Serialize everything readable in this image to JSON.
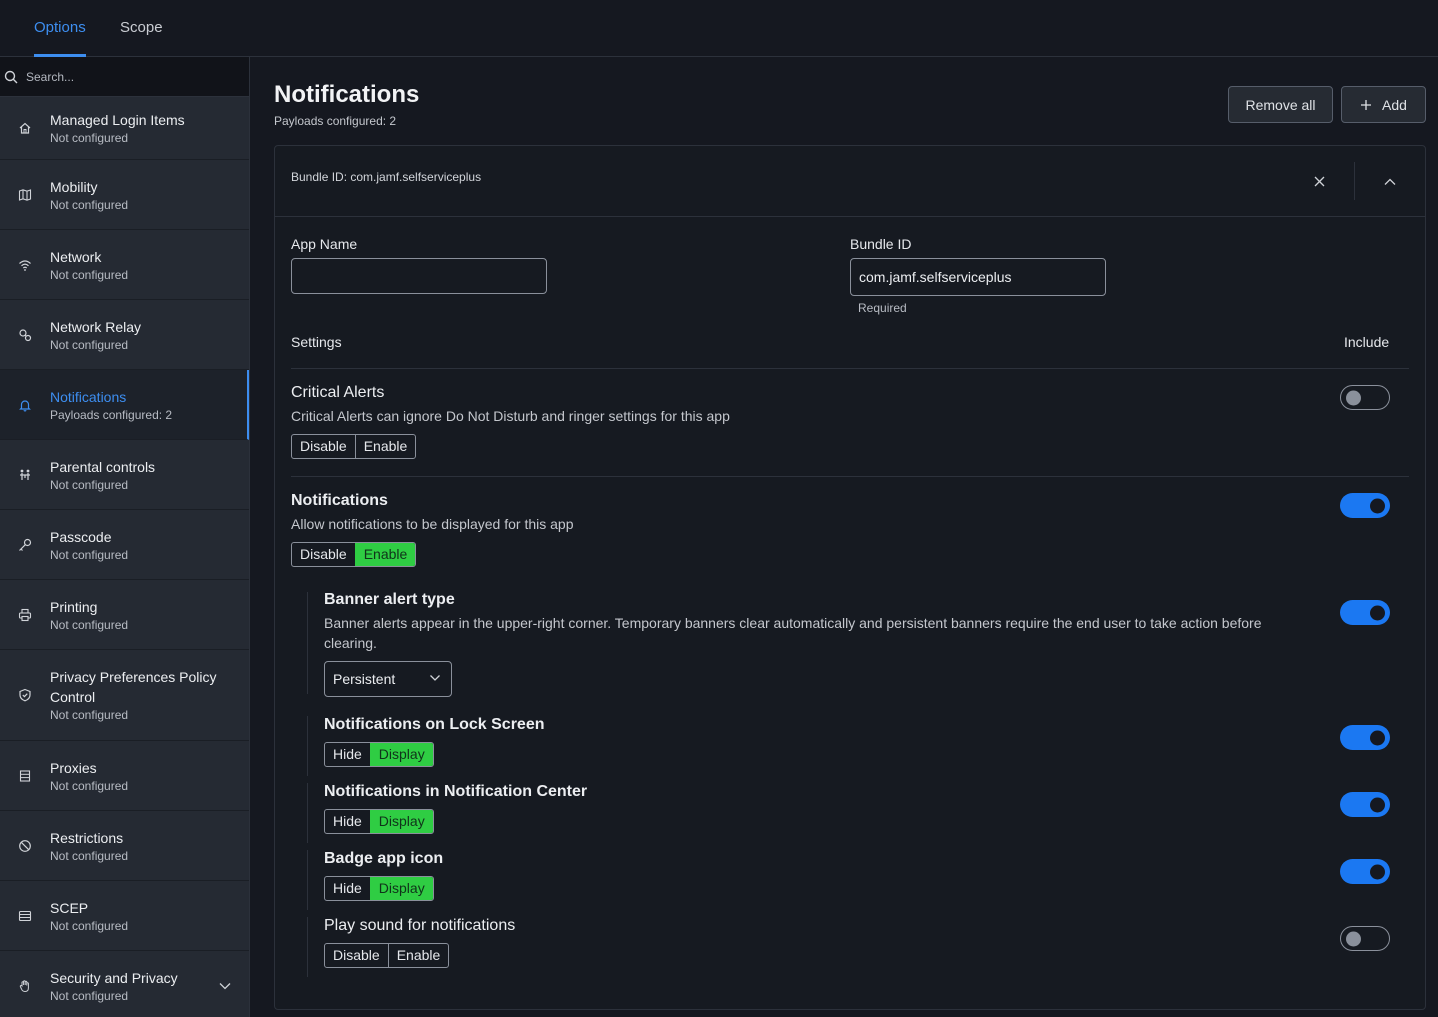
{
  "tabs": [
    {
      "label": "Options",
      "active": true
    },
    {
      "label": "Scope",
      "active": false
    }
  ],
  "sidebar": {
    "search_placeholder": "Search...",
    "items": [
      {
        "label": "Managed Login Items",
        "status": "Not configured",
        "icon": "home-icon"
      },
      {
        "label": "Mobility",
        "status": "Not configured",
        "icon": "map-icon"
      },
      {
        "label": "Network",
        "status": "Not configured",
        "icon": "wifi-icon"
      },
      {
        "label": "Network Relay",
        "status": "Not configured",
        "icon": "relay-icon"
      },
      {
        "label": "Notifications",
        "status": "Payloads configured: 2",
        "icon": "bell-icon",
        "active": true
      },
      {
        "label": "Parental controls",
        "status": "Not configured",
        "icon": "family-icon"
      },
      {
        "label": "Passcode",
        "status": "Not configured",
        "icon": "key-icon"
      },
      {
        "label": "Printing",
        "status": "Not configured",
        "icon": "printer-icon"
      },
      {
        "label": "Privacy Preferences Policy Control",
        "status": "Not configured",
        "icon": "shield-icon"
      },
      {
        "label": "Proxies",
        "status": "Not configured",
        "icon": "server-icon"
      },
      {
        "label": "Restrictions",
        "status": "Not configured",
        "icon": "block-icon"
      },
      {
        "label": "SCEP",
        "status": "Not configured",
        "icon": "certificate-icon"
      },
      {
        "label": "Security and Privacy",
        "status": "Not configured",
        "icon": "hand-icon"
      }
    ]
  },
  "main": {
    "title": "Notifications",
    "subtitle": "Payloads configured: 2",
    "remove_all_label": "Remove all",
    "add_label": "Add",
    "card": {
      "header": "Bundle ID: com.jamf.selfserviceplus",
      "app_name_label": "App Name",
      "app_name_value": "",
      "bundle_id_label": "Bundle ID",
      "bundle_id_value": "com.jamf.selfserviceplus",
      "bundle_id_helper": "Required",
      "settings_label": "Settings",
      "include_label": "Include",
      "critical_alerts": {
        "title": "Critical Alerts",
        "desc": "Critical Alerts can ignore Do Not Disturb and ringer settings for this app",
        "options": [
          "Disable",
          "Enable"
        ],
        "selected": null,
        "include": false
      },
      "notifications": {
        "title": "Notifications",
        "desc": "Allow notifications to be displayed for this app",
        "options": [
          "Disable",
          "Enable"
        ],
        "selected": "Enable",
        "include": true
      },
      "banner_alert": {
        "title": "Banner alert type",
        "desc": "Banner alerts appear in the upper-right corner. Temporary banners clear automatically and persistent banners require the end user to take action before clearing.",
        "value": "Persistent",
        "include": true
      },
      "lock_screen": {
        "title": "Notifications on Lock Screen",
        "options": [
          "Hide",
          "Display"
        ],
        "selected": "Display",
        "include": true
      },
      "notification_center": {
        "title": "Notifications in Notification Center",
        "options": [
          "Hide",
          "Display"
        ],
        "selected": "Display",
        "include": true
      },
      "badge": {
        "title": "Badge app icon",
        "options": [
          "Hide",
          "Display"
        ],
        "selected": "Display",
        "include": true
      },
      "sound": {
        "title": "Play sound for notifications",
        "options": [
          "Disable",
          "Enable"
        ],
        "selected": null,
        "include": false
      }
    }
  },
  "colors": {
    "accent": "#3d8ef0",
    "toggle_on": "#1b78f2",
    "segment_on": "#2fcd43"
  }
}
